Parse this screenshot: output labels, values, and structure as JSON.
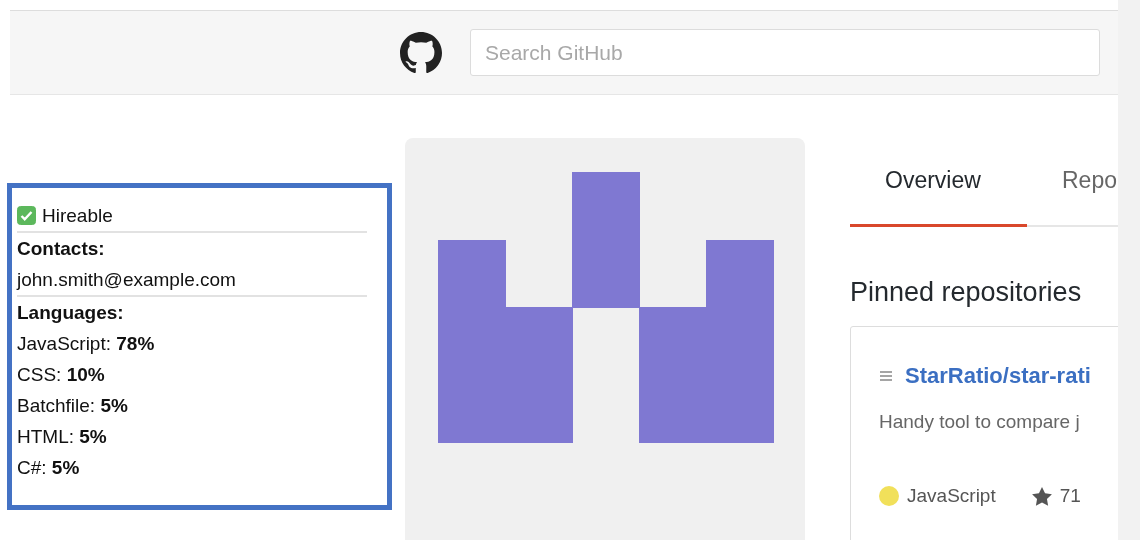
{
  "header": {
    "search": {
      "placeholder": "Search GitHub"
    }
  },
  "info_box": {
    "hireable": {
      "label": "Hireable",
      "checked": true
    },
    "contacts_heading": "Contacts:",
    "email": "john.smith@example.com",
    "languages_heading": "Languages:",
    "languages": [
      "JavaScript: **78%**",
      "CSS: **10%**",
      "Batchfile: **5%**",
      "HTML: **5%**",
      "C#: **5%**"
    ]
  },
  "profile": {
    "tabs": [
      {
        "label": "Overview",
        "selected": true
      },
      {
        "label": "Repo",
        "selected": false
      }
    ],
    "pinned_heading": "Pinned repositories",
    "pinned": [
      {
        "name": "StarRatio/star-rati",
        "description": "Handy tool to compare j",
        "language": "JavaScript",
        "color": "#f1e05a",
        "star_count": "71"
      }
    ]
  }
}
